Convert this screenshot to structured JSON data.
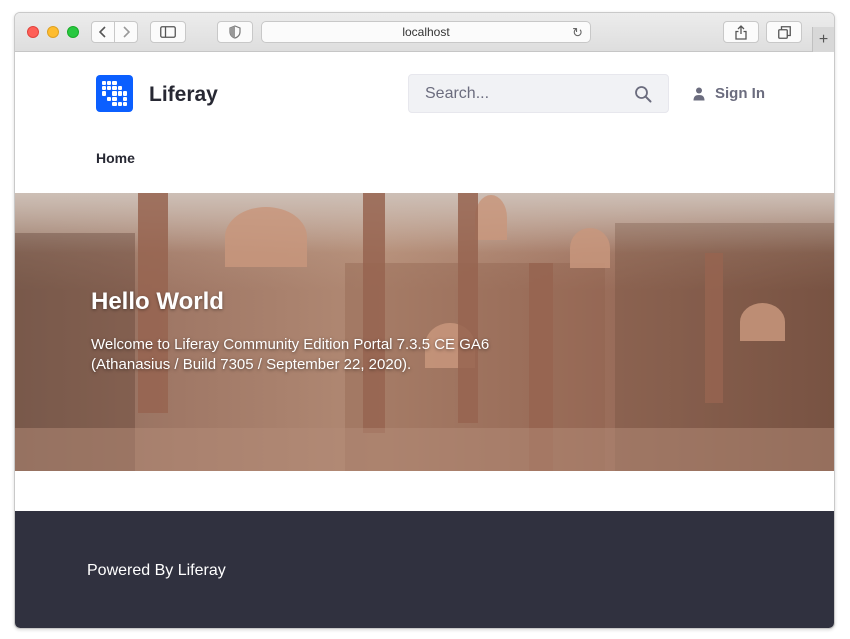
{
  "browser": {
    "address": "localhost",
    "icons": {
      "back": "chevron-left-icon",
      "forward": "chevron-right-icon",
      "sidebar": "sidebar-icon",
      "shield": "shield-icon",
      "reload": "reload-icon",
      "share": "share-icon",
      "tabs": "tabs-icon",
      "new_tab": "plus-icon"
    }
  },
  "header": {
    "site_name": "Liferay",
    "search_placeholder": "Search...",
    "sign_in": "Sign In"
  },
  "nav": {
    "items": [
      {
        "label": "Home"
      }
    ]
  },
  "hero": {
    "title": "Hello World",
    "text": "Welcome to Liferay Community Edition Portal 7.3.5 CE GA6 (Athanasius / Build 7305 / September 22, 2020)."
  },
  "footer": {
    "text": "Powered By Liferay"
  },
  "colors": {
    "accent": "#0b5fff",
    "footer_bg": "#30313f",
    "text_dark": "#272833"
  }
}
